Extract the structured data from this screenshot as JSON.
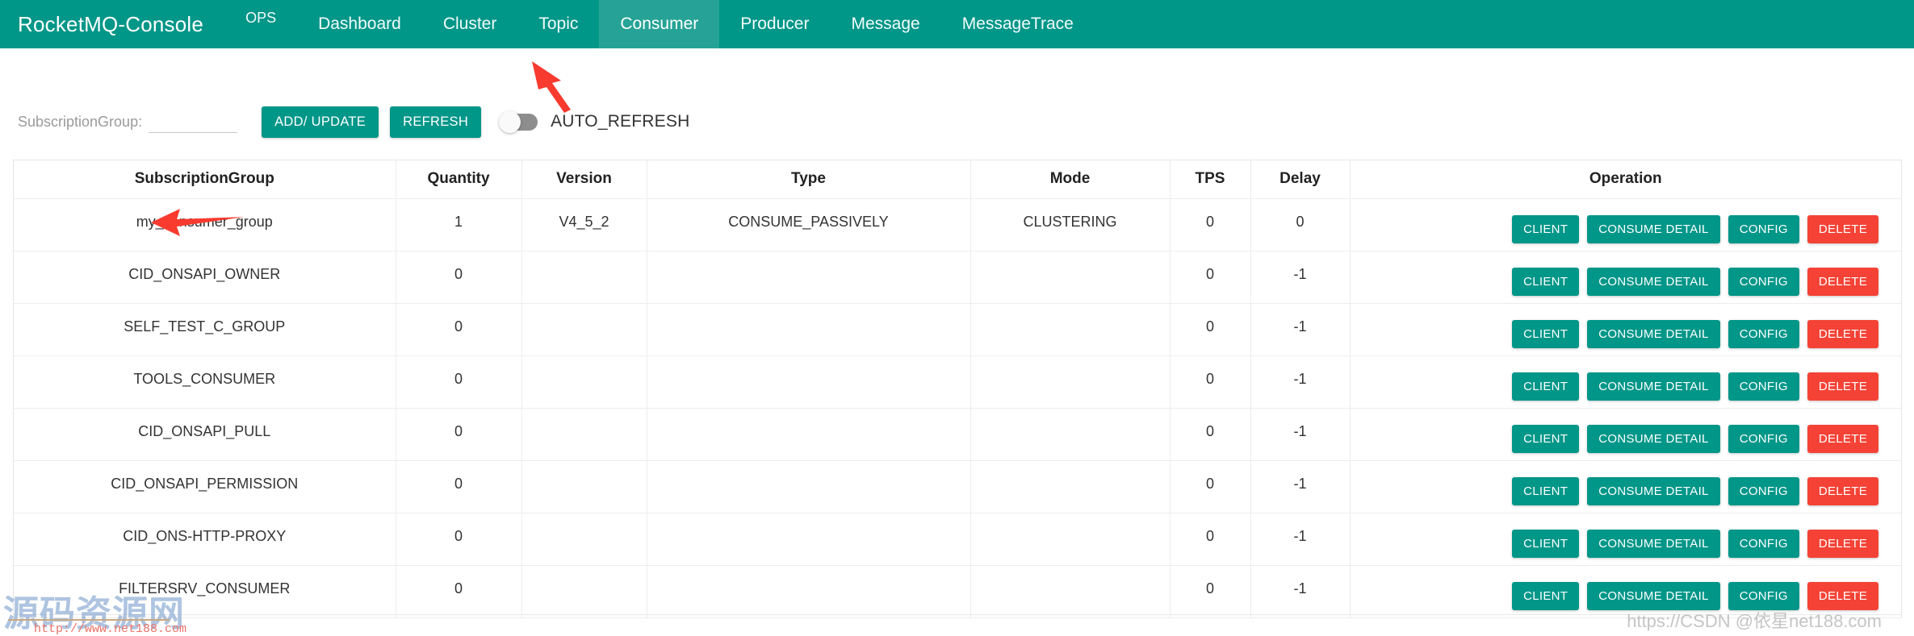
{
  "nav": {
    "brand": "RocketMQ-Console",
    "items": [
      {
        "label": "OPS",
        "active": false,
        "small": true
      },
      {
        "label": "Dashboard",
        "active": false,
        "small": false
      },
      {
        "label": "Cluster",
        "active": false,
        "small": false
      },
      {
        "label": "Topic",
        "active": false,
        "small": false
      },
      {
        "label": "Consumer",
        "active": true,
        "small": false
      },
      {
        "label": "Producer",
        "active": false,
        "small": false
      },
      {
        "label": "Message",
        "active": false,
        "small": false
      },
      {
        "label": "MessageTrace",
        "active": false,
        "small": false
      }
    ]
  },
  "toolbar": {
    "field_label": "SubscriptionGroup:",
    "field_value": "",
    "field_placeholder": "",
    "add_update_label": "ADD/ UPDATE",
    "refresh_label": "REFRESH",
    "auto_refresh_label": "AUTO_REFRESH",
    "auto_refresh_on": false
  },
  "table": {
    "headers": [
      {
        "label": "SubscriptionGroup",
        "sortable": true
      },
      {
        "label": "Quantity",
        "sortable": true
      },
      {
        "label": "Version",
        "sortable": false
      },
      {
        "label": "Type",
        "sortable": false
      },
      {
        "label": "Mode",
        "sortable": false
      },
      {
        "label": "TPS",
        "sortable": true
      },
      {
        "label": "Delay",
        "sortable": true
      },
      {
        "label": "Operation",
        "sortable": false
      }
    ],
    "row_buttons": [
      {
        "label": "CLIENT",
        "style": "teal"
      },
      {
        "label": "CONSUME DETAIL",
        "style": "teal"
      },
      {
        "label": "CONFIG",
        "style": "teal"
      },
      {
        "label": "DELETE",
        "style": "red"
      }
    ],
    "rows": [
      {
        "group": "my_consumer_group",
        "quantity": "1",
        "version": "V4_5_2",
        "type": "CONSUME_PASSIVELY",
        "mode": "CLUSTERING",
        "tps": "0",
        "delay": "0"
      },
      {
        "group": "CID_ONSAPI_OWNER",
        "quantity": "0",
        "version": "",
        "type": "",
        "mode": "",
        "tps": "0",
        "delay": "-1"
      },
      {
        "group": "SELF_TEST_C_GROUP",
        "quantity": "0",
        "version": "",
        "type": "",
        "mode": "",
        "tps": "0",
        "delay": "-1"
      },
      {
        "group": "TOOLS_CONSUMER",
        "quantity": "0",
        "version": "",
        "type": "",
        "mode": "",
        "tps": "0",
        "delay": "-1"
      },
      {
        "group": "CID_ONSAPI_PULL",
        "quantity": "0",
        "version": "",
        "type": "",
        "mode": "",
        "tps": "0",
        "delay": "-1"
      },
      {
        "group": "CID_ONSAPI_PERMISSION",
        "quantity": "0",
        "version": "",
        "type": "",
        "mode": "",
        "tps": "0",
        "delay": "-1"
      },
      {
        "group": "CID_ONS-HTTP-PROXY",
        "quantity": "0",
        "version": "",
        "type": "",
        "mode": "",
        "tps": "0",
        "delay": "-1"
      },
      {
        "group": "FILTERSRV_CONSUMER",
        "quantity": "0",
        "version": "",
        "type": "",
        "mode": "",
        "tps": "0",
        "delay": "-1"
      }
    ]
  },
  "watermarks": {
    "chinese": "源码资源网",
    "url": "http://www.net188.com",
    "csdn": "https://CSDN @依星net188.com"
  },
  "colors": {
    "brand_teal": "#009688",
    "active_tab": "#26a396",
    "danger_red": "#f44336",
    "sort_link_blue": "#45b5f5",
    "annotation_red": "#f93a2f"
  }
}
